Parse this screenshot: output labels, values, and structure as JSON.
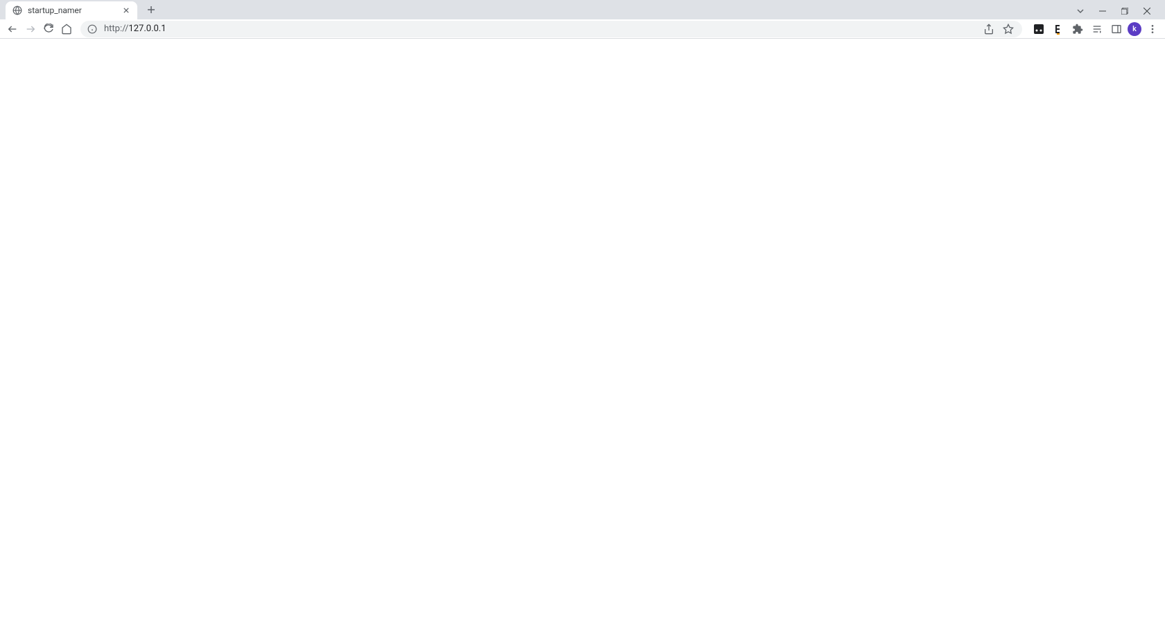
{
  "tab": {
    "title": "startup_namer"
  },
  "address": {
    "scheme": "http://",
    "host": "127.0.0.1"
  },
  "profile": {
    "initial": "k",
    "color": "#5b3cc4"
  }
}
